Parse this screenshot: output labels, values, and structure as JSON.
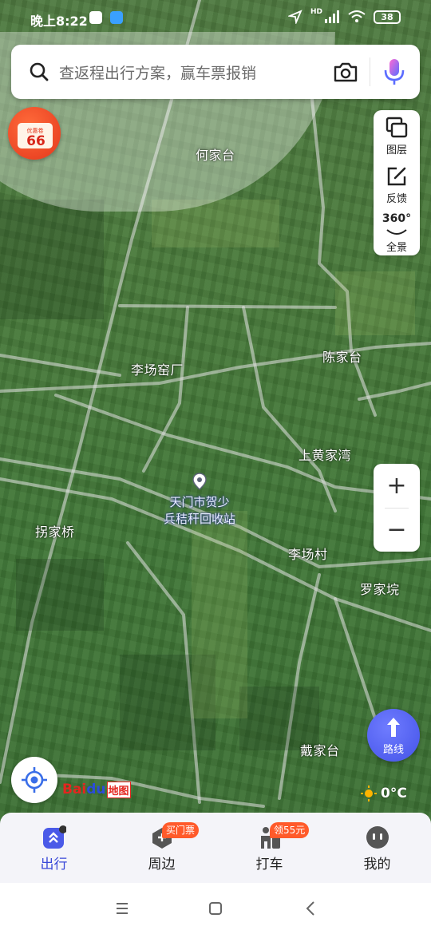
{
  "status_bar": {
    "time": "晚上8:22",
    "battery": "38",
    "network": "HD"
  },
  "search": {
    "placeholder": "查返程出行方案，赢车票报销",
    "camera_icon": "camera-icon",
    "voice_icon": "microphone-icon"
  },
  "promo": {
    "title": "优惠卷",
    "value": "66"
  },
  "tools": [
    {
      "label": "图层",
      "icon": "layers-icon"
    },
    {
      "label": "反馈",
      "icon": "feedback-icon"
    },
    {
      "label": "全景",
      "icon": "panorama-360-icon",
      "icon_text": "360°"
    }
  ],
  "map": {
    "places": [
      {
        "name": "何家台"
      },
      {
        "name": "李场窑厂"
      },
      {
        "name": "陈家台"
      },
      {
        "name": "上黄家湾"
      },
      {
        "name": "拐家桥"
      },
      {
        "name": "李场村"
      },
      {
        "name": "罗家垸"
      },
      {
        "name": "戴家台"
      }
    ],
    "poi": {
      "line1": "天门市贺少",
      "line2": "兵秸秆回收站"
    }
  },
  "zoom": {
    "in": "+",
    "out": "−"
  },
  "route": {
    "label": "路线"
  },
  "logo": {
    "bai": "Bai",
    "du": "du",
    "ditu": "地图"
  },
  "weather": {
    "temperature": "0°C",
    "icon": "sun-icon"
  },
  "bottom_nav": [
    {
      "label": "出行",
      "icon": "travel-icon",
      "active": true
    },
    {
      "label": "周边",
      "icon": "nearby-icon",
      "badge": "买门票"
    },
    {
      "label": "打车",
      "icon": "taxi-icon",
      "badge": "领55元"
    },
    {
      "label": "我的",
      "icon": "profile-icon"
    }
  ],
  "colors": {
    "accent": "#3a49d8",
    "badge": "#ff5a2a",
    "promo": "#e4371c"
  }
}
